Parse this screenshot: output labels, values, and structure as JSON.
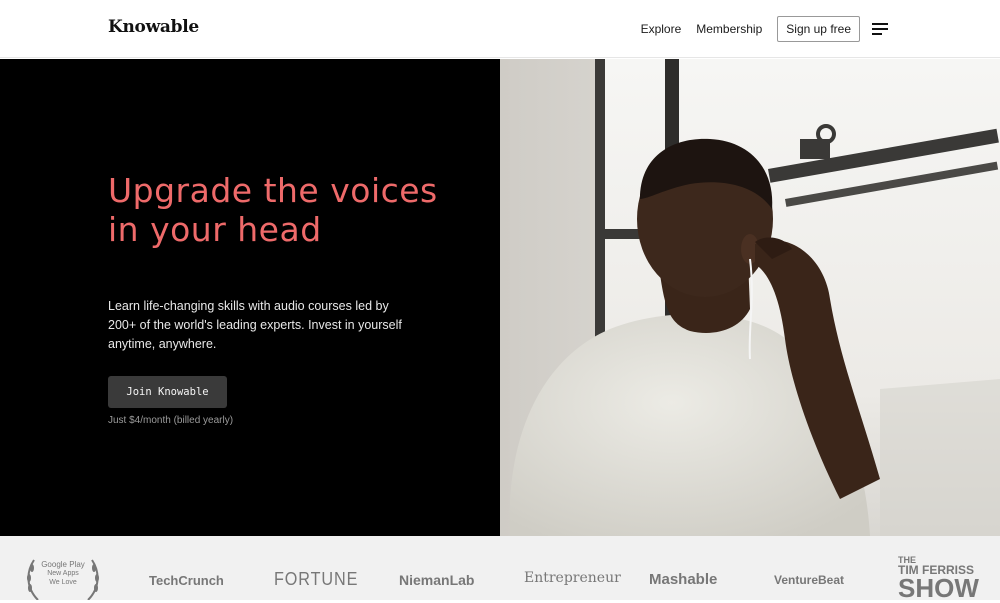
{
  "header": {
    "logo": "Knowable",
    "nav": {
      "explore": "Explore",
      "membership": "Membership",
      "signup": "Sign up free"
    }
  },
  "hero": {
    "title": "Upgrade the voices in your head",
    "subtitle": "Learn life-changing skills with audio courses led by 200+ of the world's leading experts. Invest in yourself anytime, anywhere.",
    "cta": "Join Knowable",
    "price_note": "Just $4/month (billed yearly)"
  },
  "press": {
    "award_line1": "Google Play",
    "award_line2": "New Apps",
    "award_line3": "We Love",
    "logos": [
      "TechCrunch",
      "FORTUNE",
      "NiemanLab",
      "Entrepreneur",
      "Mashable",
      "VentureBeat"
    ],
    "tim_ferriss_top": "THE",
    "tim_ferriss_mid": "TIM FERRISS",
    "tim_ferriss_bottom": "SHOW"
  },
  "colors": {
    "accent": "#ee6a6a",
    "hero_bg": "#000000",
    "press_bg": "#f1f1f1"
  }
}
